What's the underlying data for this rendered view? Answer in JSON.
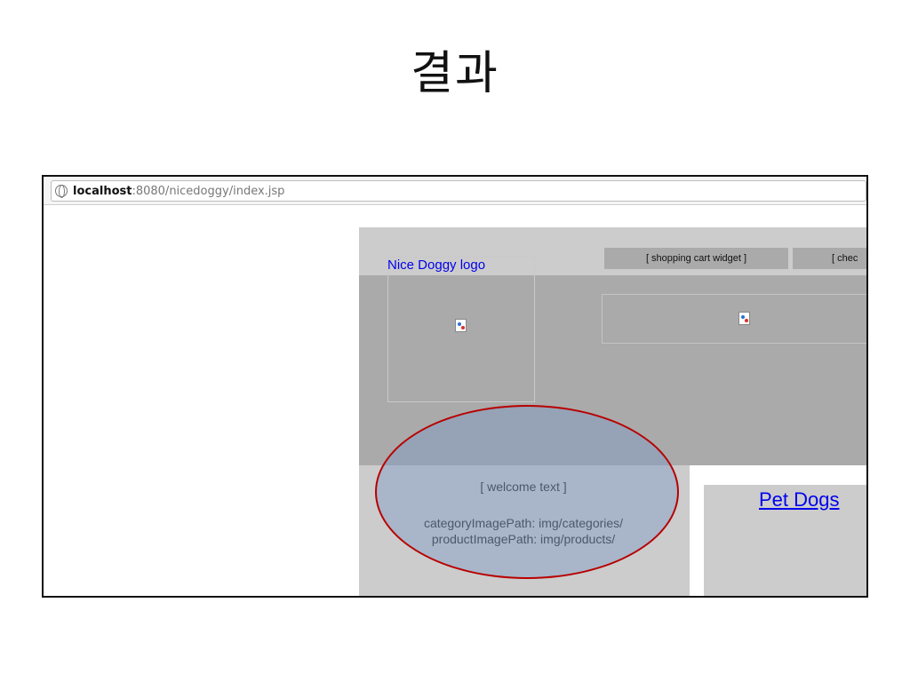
{
  "slide": {
    "title": "결과"
  },
  "browser": {
    "url_host": "localhost",
    "url_rest": ":8080/nicedoggy/index.jsp"
  },
  "page": {
    "logo_label": "Nice Doggy logo",
    "cart_widget": "[ shopping cart widget ]",
    "checkout_widget": "[ chec",
    "welcome_text": "[ welcome text ]",
    "category_image_path": "categoryImagePath: img/categories/",
    "product_image_path": "productImagePath: img/products/",
    "category_link": "Pet Dogs"
  },
  "colors": {
    "highlight_border": "#b80000",
    "link": "#0000ee",
    "header_band": "#aaaaaa",
    "content_bg": "#cccccc"
  }
}
